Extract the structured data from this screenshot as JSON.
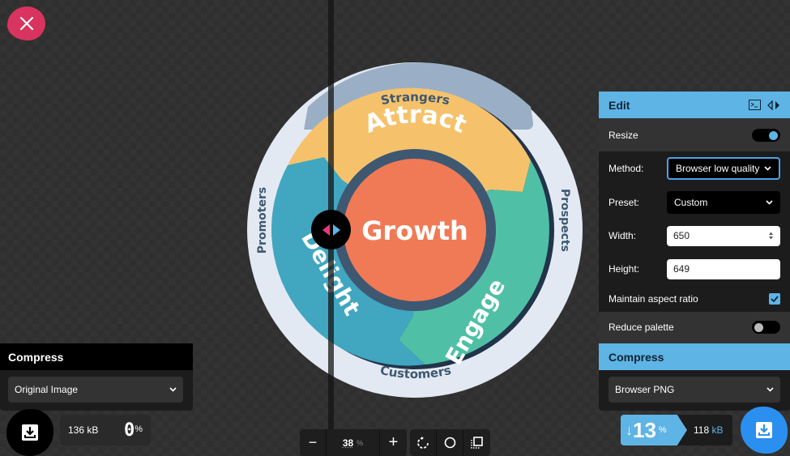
{
  "close_button": {
    "icon": "close-icon"
  },
  "image": {
    "center_label": "Growth",
    "segments": [
      {
        "label": "Attract",
        "color": "#f5c26b"
      },
      {
        "label": "Engage",
        "color": "#4fc0a6"
      },
      {
        "label": "Delight",
        "color": "#41a6c0"
      }
    ],
    "ring_labels": [
      "Strangers",
      "Prospects",
      "Customers",
      "Promoters"
    ],
    "center_color": "#f07a55",
    "ring_color": "#3e5871"
  },
  "edit_panel": {
    "title": "Edit",
    "resize": {
      "label": "Resize",
      "on": true
    },
    "method": {
      "label": "Method:",
      "value": "Browser low quality"
    },
    "preset": {
      "label": "Preset:",
      "value": "Custom"
    },
    "width": {
      "label": "Width:",
      "value": "650"
    },
    "height": {
      "label": "Height:",
      "value": "649"
    },
    "maintain_aspect": {
      "label": "Maintain aspect ratio",
      "checked": true
    },
    "reduce_palette": {
      "label": "Reduce palette",
      "on": false
    }
  },
  "compress_right": {
    "title": "Compress",
    "value": "Browser PNG",
    "size_value": "118",
    "size_unit": "kB",
    "reduction_arrow": "↓",
    "reduction": "13",
    "percent_sign": "%"
  },
  "compress_left": {
    "title": "Compress",
    "value": "Original Image",
    "size": "136 kB",
    "reduction": "0",
    "percent_sign": "%"
  },
  "zoom_controls": {
    "minus": "−",
    "plus": "+",
    "value": "38",
    "unit": "%"
  },
  "colors": {
    "accent": "#5eb4e4",
    "download_right": "#2b8ff0",
    "close": "#d8345f",
    "divider_left_arrow": "#e8397a",
    "divider_right_arrow": "#5eb4e4"
  }
}
